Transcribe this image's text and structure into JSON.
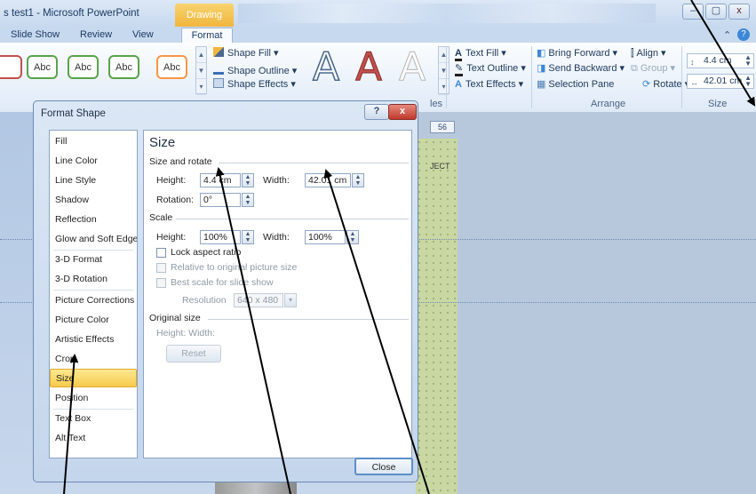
{
  "window": {
    "title": "s test1 - Microsoft PowerPoint",
    "context_tab": "Drawing Tools",
    "buttons": {
      "minimize": "–",
      "maximize": "▢",
      "close": "x"
    }
  },
  "tabs": {
    "slideshow": "Slide Show",
    "review": "Review",
    "view": "View",
    "format": "Format"
  },
  "ribbon": {
    "abc": "Abc",
    "shape_fill": "Shape Fill ▾",
    "shape_outline": "Shape Outline ▾",
    "shape_effects": "Shape Effects ▾",
    "wordart_letter": "A",
    "text_fill": "Text Fill ▾",
    "text_outline": "Text Outline ▾",
    "text_effects": "Text Effects ▾",
    "bring_forward": "Bring Forward ▾",
    "send_backward": "Send Backward ▾",
    "selection_pane": "Selection Pane",
    "align": "Align ▾",
    "group": "Group ▾",
    "rotate": "Rotate ▾",
    "group_styles": "les",
    "group_arrange": "Arrange",
    "group_size": "Size",
    "size_height": "4.4 cm",
    "size_width": "42.01 cm"
  },
  "slide": {
    "ruler_number": "56",
    "placeholder_text": "JECT"
  },
  "dialog": {
    "title": "Format Shape",
    "help": "?",
    "close_x": "x",
    "nav": [
      "Fill",
      "Line Color",
      "Line Style",
      "Shadow",
      "Reflection",
      "Glow and Soft Edges",
      "3-D Format",
      "3-D Rotation",
      "Picture Corrections",
      "Picture Color",
      "Artistic Effects",
      "Crop",
      "Size",
      "Position",
      "Text Box",
      "Alt Text"
    ],
    "selected_nav": "Size",
    "heading": "Size",
    "size_rotate": {
      "label": "Size and rotate",
      "height_label": "Height:",
      "height_value": "4.4 cm",
      "width_label": "Width:",
      "width_value": "42.01 cm",
      "rotation_label": "Rotation:",
      "rotation_value": "0°"
    },
    "scale": {
      "label": "Scale",
      "height_label": "Height:",
      "height_value": "100%",
      "width_label": "Width:",
      "width_value": "100%",
      "lock_aspect": "Lock aspect ratio",
      "relative": "Relative to original picture size",
      "best_scale": "Best scale for slide show",
      "resolution_label": "Resolution",
      "resolution_value": "640 x 480"
    },
    "original": {
      "label": "Original size",
      "dims": "Height:   Width:",
      "reset": "Reset"
    },
    "close_button": "Close"
  },
  "colors": {
    "ribbon_bg": "#dfeaf7",
    "selected_nav": "#f7cb4c",
    "context_tab": "#f1b63d"
  }
}
